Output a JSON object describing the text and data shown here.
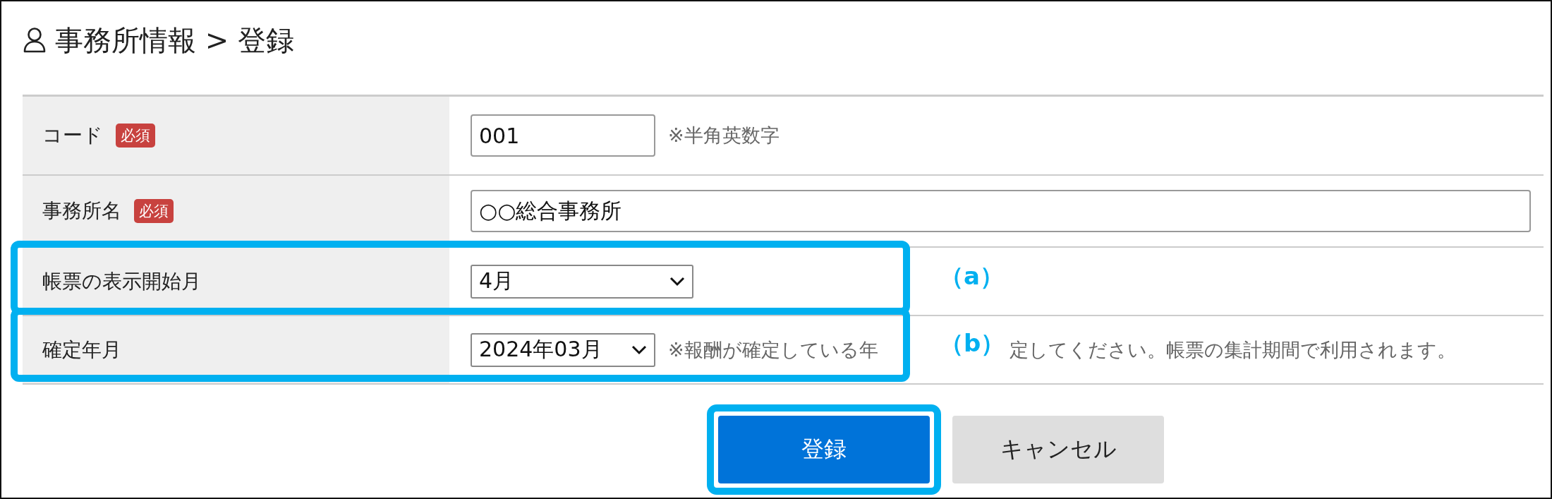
{
  "title": "事務所情報 > 登録",
  "rows": [
    {
      "kind": "text",
      "label": "コード",
      "badge": "必須",
      "value": "001",
      "hint": "※半角英数字"
    },
    {
      "kind": "text",
      "label": "事務所名",
      "badge": "必須",
      "value": "○○総合事務所"
    },
    {
      "kind": "select",
      "label": "帳票の表示開始月",
      "value": "4月",
      "callout": "（a）"
    },
    {
      "kind": "select",
      "label": "確定年月",
      "value": "2024年03月",
      "hint": "※報酬が確定している年",
      "hint_after": "定してください。帳票の集計期間で利用されます。",
      "callout": "（b）"
    }
  ],
  "buttons": [
    {
      "label": "登録",
      "kind": "primary",
      "highlighted": true
    },
    {
      "label": "キャンセル",
      "kind": "secondary",
      "highlighted": false
    }
  ]
}
